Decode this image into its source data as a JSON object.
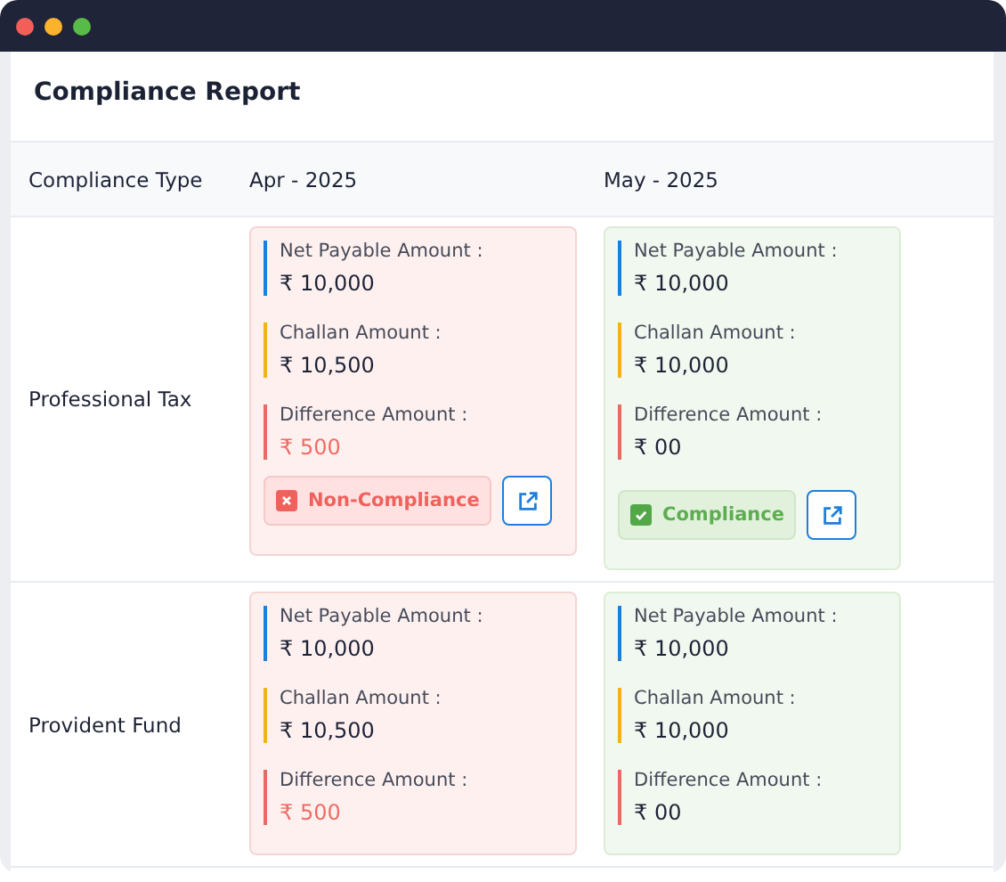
{
  "title": "Compliance Report",
  "columns": [
    "Compliance Type",
    "Apr - 2025",
    "May - 2025"
  ],
  "rows": [
    {
      "type": "Professional Tax",
      "months": [
        {
          "items": [
            {
              "label": "Net Payable Amount :",
              "value": "₹ 10,000",
              "color": "#1e7fd9",
              "warning": false
            },
            {
              "label": "Challan Amount :",
              "value": "₹ 10,500",
              "color": "#f2b21c",
              "warning": false
            },
            {
              "label": "Difference Amount :",
              "value": "₹ 500",
              "color": "#e56b65",
              "warning": true
            }
          ],
          "compliant": false,
          "status": {
            "kind": "non_compliance",
            "label": "Non-Compliance"
          }
        },
        {
          "items": [
            {
              "label": "Net Payable Amount :",
              "value": "₹ 10,000",
              "color": "#1e7fd9",
              "warning": false
            },
            {
              "label": "Challan Amount :",
              "value": "₹ 10,000",
              "color": "#f2b21c",
              "warning": false
            },
            {
              "label": "Difference Amount :",
              "value": "₹ 00",
              "color": "#e56b65",
              "warning": false
            }
          ],
          "compliant": true,
          "status": {
            "kind": "compliance",
            "label": "Compliance"
          }
        }
      ]
    },
    {
      "type": "Provident Fund",
      "months": [
        {
          "items": [
            {
              "label": "Net Payable Amount :",
              "value": "₹ 10,000",
              "color": "#1e7fd9",
              "warning": false
            },
            {
              "label": "Challan Amount :",
              "value": "₹ 10,500",
              "color": "#f2b21c",
              "warning": false
            },
            {
              "label": "Difference Amount :",
              "value": "₹ 500",
              "color": "#e56b65",
              "warning": true
            }
          ],
          "compliant": false
        },
        {
          "items": [
            {
              "label": "Net Payable Amount :",
              "value": "₹ 10,000",
              "color": "#1e7fd9",
              "warning": false
            },
            {
              "label": "Challan Amount :",
              "value": "₹ 10,000",
              "color": "#f2b21c",
              "warning": false
            },
            {
              "label": "Difference Amount :",
              "value": "₹ 00",
              "color": "#e56b65",
              "warning": false
            }
          ],
          "compliant": true
        }
      ]
    }
  ]
}
